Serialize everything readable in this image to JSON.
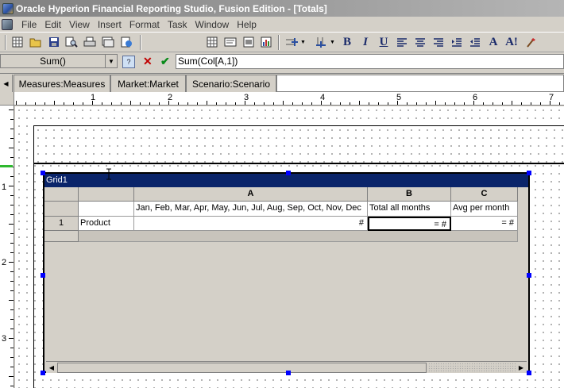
{
  "window": {
    "title": "Oracle Hyperion Financial Reporting Studio, Fusion Edition - [Totals]"
  },
  "menu": [
    "File",
    "Edit",
    "View",
    "Insert",
    "Format",
    "Task",
    "Window",
    "Help"
  ],
  "toolbar": {
    "icons": [
      "insert-grid-icon",
      "open-icon",
      "save-icon",
      "print-preview-icon",
      "print-icon",
      "web-preview-icon",
      "export-icon",
      "grid-icon",
      "text-icon",
      "image-icon",
      "chart-icon",
      "insert-row-icon",
      "insert-column-icon",
      "bold-icon",
      "italic-icon",
      "underline-icon",
      "align-left-icon",
      "align-center-icon",
      "align-right-icon",
      "decrease-indent-icon",
      "increase-indent-icon",
      "font-icon",
      "font-size-icon",
      "format-painter-icon"
    ]
  },
  "formula_bar": {
    "function": "Sum()",
    "formula": "Sum(Col[A,1])"
  },
  "dimension_tabs": [
    "Measures:Measures",
    "Market:Market",
    "Scenario:Scenario"
  ],
  "ruler": {
    "horizontal": [
      "1",
      "2",
      "3",
      "4",
      "5",
      "6",
      "7"
    ],
    "vertical": [
      "1",
      "2",
      "3"
    ]
  },
  "grid": {
    "name": "Grid1",
    "columns": [
      "A",
      "B",
      "C"
    ],
    "column_headers": [
      "Jan, Feb, Mar, Apr, May, Jun, Jul, Aug, Sep, Oct, Nov, Dec",
      "Total all months",
      "Avg per month"
    ],
    "rows": [
      {
        "number": "1",
        "label": "Product",
        "values": [
          "#",
          "= #",
          "= #"
        ]
      }
    ]
  }
}
